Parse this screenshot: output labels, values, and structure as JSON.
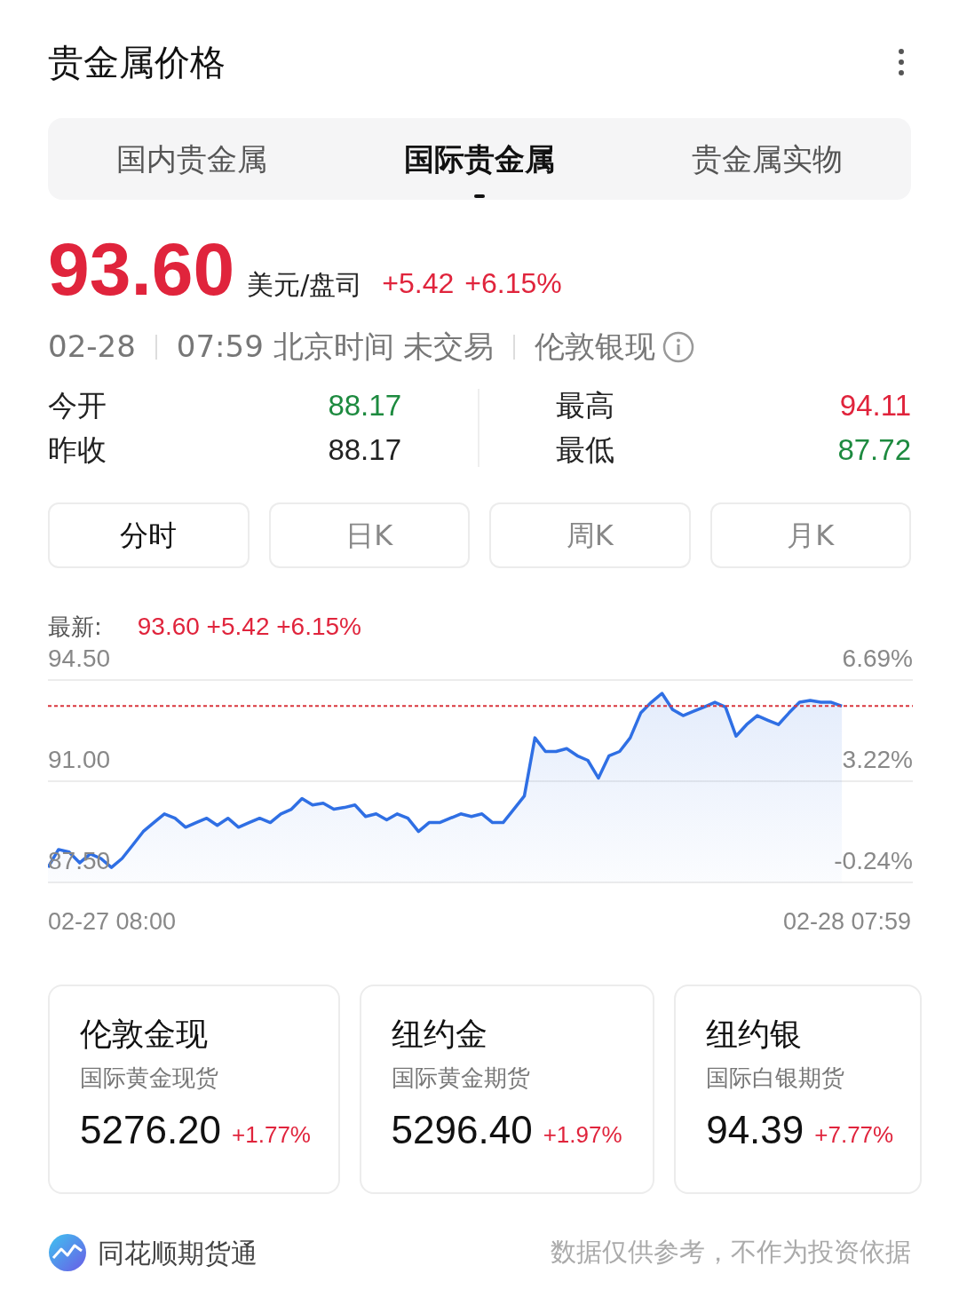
{
  "title": "贵金属价格",
  "tabs": [
    {
      "label": "国内贵金属",
      "selected": false
    },
    {
      "label": "国际贵金属",
      "selected": true
    },
    {
      "label": "贵金属实物",
      "selected": false
    }
  ],
  "quote": {
    "price": "93.60",
    "unit": "美元/盘司",
    "change": "+5.42",
    "change_pct": "+6.15%"
  },
  "info": {
    "date": "02-28",
    "time": "07:59 北京时间 未交易",
    "name": "伦敦银现"
  },
  "stats": [
    {
      "label": "今开",
      "value": "88.17",
      "color": "#1d8a3f"
    },
    {
      "label": "昨收",
      "value": "88.17",
      "color": "#222222"
    },
    {
      "label": "最高",
      "value": "94.11",
      "color": "#e0243c"
    },
    {
      "label": "最低",
      "value": "87.72",
      "color": "#1d8a3f"
    }
  ],
  "periods": [
    {
      "label": "分时",
      "selected": true
    },
    {
      "label": "日K",
      "selected": false
    },
    {
      "label": "周K",
      "selected": false
    },
    {
      "label": "月K",
      "selected": false
    }
  ],
  "latest": {
    "label": "最新:",
    "value": "93.60 +5.42 +6.15%"
  },
  "chart": {
    "percent_labels": [
      "6.69%",
      "3.22%",
      "-0.24%"
    ],
    "start_time": "02-27 08:00",
    "end_time": "02-28 07:59",
    "chart_data": {
      "type": "area",
      "ylim": [
        87.5,
        94.5
      ],
      "yticks": [
        {
          "value": 94.5,
          "label": "94.50"
        },
        {
          "value": 91,
          "label": "91.00"
        },
        {
          "value": 87.5,
          "label": "87.50"
        }
      ],
      "series": [
        {
          "color": "#2f6fe4",
          "values": [
            88.02,
            88.64,
            88.55,
            88.18,
            88.49,
            88.33,
            88.02,
            88.33,
            88.79,
            89.26,
            89.57,
            89.87,
            89.72,
            89.41,
            89.57,
            89.72,
            89.47,
            89.72,
            89.41,
            89.57,
            89.72,
            89.57,
            89.87,
            90.03,
            90.4,
            90.18,
            90.24,
            90.03,
            90.09,
            90.18,
            89.78,
            89.87,
            89.66,
            89.87,
            89.72,
            89.26,
            89.57,
            89.57,
            89.72,
            89.87,
            89.78,
            89.87,
            89.57,
            89.57,
            90.03,
            90.49,
            92.5,
            92.03,
            92.03,
            92.13,
            91.88,
            91.72,
            91.11,
            91.88,
            92.03,
            92.5,
            93.36,
            93.73,
            94.04,
            93.48,
            93.27,
            93.42,
            93.57,
            93.73,
            93.57,
            92.56,
            92.96,
            93.27,
            93.11,
            92.96,
            93.36,
            93.73,
            93.79,
            93.73,
            93.73,
            93.6
          ]
        }
      ],
      "ref_lines": [
        {
          "axis": "y",
          "value": 93.6
        }
      ]
    }
  },
  "cards": [
    {
      "name": "伦敦金现",
      "desc": "国际黄金现货",
      "price": "5276.20",
      "change": "+1.77%"
    },
    {
      "name": "纽约金",
      "desc": "国际黄金期货",
      "price": "5296.40",
      "change": "+1.97%"
    },
    {
      "name": "纽约银",
      "desc": "国际白银期货",
      "price": "94.39",
      "change": "+7.77%"
    }
  ],
  "footer": {
    "brand": "同花顺期货通",
    "disclaimer": "数据仅供参考，不作为投资依据"
  }
}
